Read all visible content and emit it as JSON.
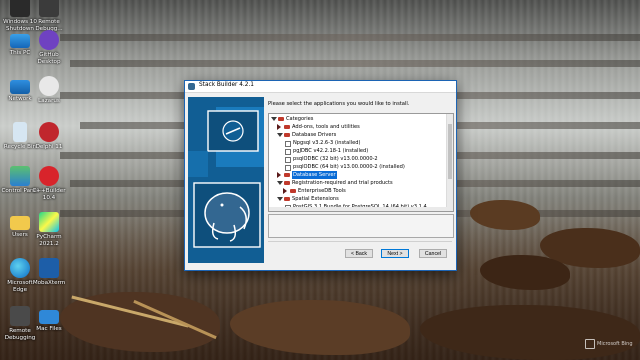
{
  "desktop": {
    "icons": [
      {
        "label": "Windows 10 Shutdown",
        "icon": "shutdown-icon"
      },
      {
        "label": "Remote Debugg...",
        "icon": "remote-debugger-icon"
      },
      {
        "label": "This PC",
        "icon": "this-pc-icon"
      },
      {
        "label": "GitHub Desktop",
        "icon": "github-icon"
      },
      {
        "label": "Network",
        "icon": "network-icon"
      },
      {
        "label": "Lazarus",
        "icon": "lazarus-icon"
      },
      {
        "label": "Recycle Bin",
        "icon": "recycle-bin-icon"
      },
      {
        "label": "Delphi 11",
        "icon": "delphi-icon"
      },
      {
        "label": "Control Panel",
        "icon": "control-panel-icon"
      },
      {
        "label": "C++Builder 10.4",
        "icon": "cppbuilder-icon"
      },
      {
        "label": "Users",
        "icon": "folder-icon"
      },
      {
        "label": "PyCharm 2021.2",
        "icon": "pycharm-icon"
      },
      {
        "label": "Microsoft Edge",
        "icon": "edge-icon"
      },
      {
        "label": "MobaXterm",
        "icon": "mobaxterm-icon"
      },
      {
        "label": "Remote Debugging",
        "icon": "remote-debugging-icon"
      },
      {
        "label": "Mac Files",
        "icon": "folder-icon"
      }
    ],
    "watermark": "Microsoft Bing"
  },
  "dialog": {
    "title": "Stack Builder 4.2.1",
    "instruction": "Please select the applications you would like to install.",
    "tree": [
      {
        "label": "Categories",
        "depth": 0,
        "kind": "category",
        "expanded": true
      },
      {
        "label": "Add-ons, tools and utilities",
        "depth": 1,
        "kind": "category",
        "expanded": false
      },
      {
        "label": "Database Drivers",
        "depth": 1,
        "kind": "category",
        "expanded": true
      },
      {
        "label": "Npgsql v3.2.6-3 (installed)",
        "depth": 2,
        "kind": "item"
      },
      {
        "label": "pgJDBC v42.2.18-1 (installed)",
        "depth": 2,
        "kind": "item"
      },
      {
        "label": "psqlODBC (32 bit) v13.00.0000-2",
        "depth": 2,
        "kind": "item"
      },
      {
        "label": "psqlODBC (64 bit) v13.00.0000-2 (installed)",
        "depth": 2,
        "kind": "item"
      },
      {
        "label": "Database Server",
        "depth": 1,
        "kind": "category",
        "expanded": false,
        "selected": true
      },
      {
        "label": "Registration-required and trial products",
        "depth": 1,
        "kind": "category",
        "expanded": true
      },
      {
        "label": "EnterpriseDB Tools",
        "depth": 2,
        "kind": "category",
        "expanded": false
      },
      {
        "label": "Spatial Extensions",
        "depth": 1,
        "kind": "category",
        "expanded": true
      },
      {
        "label": "PostGIS 3.1 Bundle for PostgreSQL 14 (64 bit) v3.1.4",
        "depth": 2,
        "kind": "item"
      }
    ],
    "buttons": {
      "back": "< Back",
      "next": "Next >",
      "cancel": "Cancel"
    },
    "colors": {
      "side_panel": "#115e94",
      "selection": "#0a6cd6"
    }
  }
}
